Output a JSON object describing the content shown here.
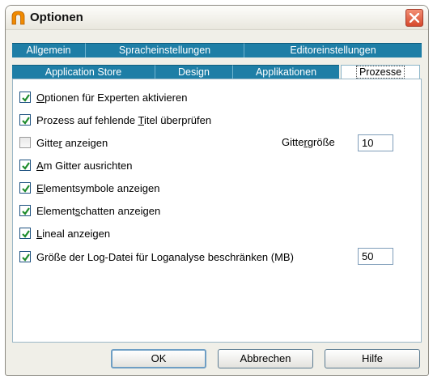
{
  "window": {
    "title": "Optionen"
  },
  "tabs": {
    "row1": [
      "Allgemein",
      "Spracheinstellungen",
      "Editoreinstellungen"
    ],
    "row2": [
      "Application Store",
      "Design",
      "Applikationen",
      "Prozesse"
    ],
    "active": "Prozesse"
  },
  "options": [
    {
      "pre": "",
      "mn": "O",
      "post": "ptionen für Experten aktivieren",
      "checked": true
    },
    {
      "pre": "Prozess auf fehlende ",
      "mn": "T",
      "post": "itel überprüfen",
      "checked": true
    },
    {
      "pre": "Gitte",
      "mn": "r",
      "post": " anzeigen",
      "checked": false
    },
    {
      "pre": "",
      "mn": "A",
      "post": "m Gitter ausrichten",
      "checked": true
    },
    {
      "pre": "",
      "mn": "E",
      "post": "lementsymbole anzeigen",
      "checked": true
    },
    {
      "pre": "Element",
      "mn": "s",
      "post": "chatten anzeigen",
      "checked": true
    },
    {
      "pre": "",
      "mn": "L",
      "post": "ineal anzeigen",
      "checked": true
    },
    {
      "pre": "Größe der Log-Datei für Loganalyse beschränken (MB)",
      "mn": "",
      "post": "",
      "checked": true
    }
  ],
  "grid_size": {
    "pre": "Gitte",
    "mn": "r",
    "post": "größe",
    "value": "10"
  },
  "log_size": {
    "value": "50"
  },
  "buttons": {
    "ok": "OK",
    "cancel": "Abbrechen",
    "help": "Hilfe"
  }
}
